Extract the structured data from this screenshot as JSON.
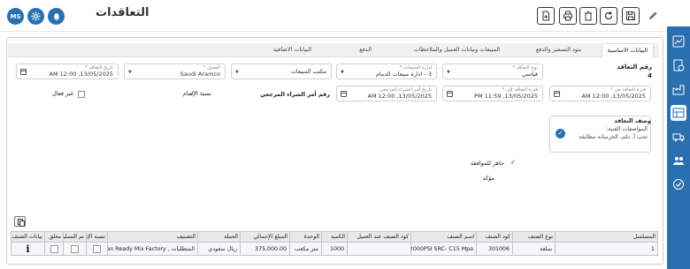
{
  "header": {
    "title": "التعاقدات",
    "user_initials": "MS"
  },
  "tabs": [
    {
      "label": "البيانات الاساسية"
    },
    {
      "label": "بنود التسعير والدفع"
    },
    {
      "label": "المبيعات وبيانات العميل والملاحظات"
    },
    {
      "label": "الدفع"
    },
    {
      "label": "البيانات الاضافية"
    }
  ],
  "form": {
    "contract_no": {
      "label": "رقم التعاقد",
      "value": "4"
    },
    "contract_type": {
      "label": "نوع التعاقد *",
      "value": "قياسي"
    },
    "sales_admin": {
      "label": "إدارة المبيعات *",
      "value": "3 - ادارة مبيعات الدمام"
    },
    "sales_office": {
      "label": "",
      "value": "مكتب المبيعات"
    },
    "customer": {
      "label": "العميل *",
      "value": "Saudi Aramco"
    },
    "contract_date": {
      "label": "تاريخ التعاقد *",
      "value": "13/05/2025, 12:00 AM"
    },
    "period_from": {
      "label": "فترة التعاقد من *",
      "value": "13/05/2025, 12:00 AM"
    },
    "period_to": {
      "label": "فترة التعاقد إلى *",
      "value": "13/05/2025, 11:59 PM"
    },
    "po_date": {
      "label": "تاريخ أمر الشراء المرجعي",
      "value": "13/05/2025, 12:00 AM"
    },
    "po_ref_label": "رقم أمر الشراء المرجعي",
    "completion_ratio": "نسبة الإتمام",
    "inactive": "غير فعال",
    "desc_label": "وصف التعاقد",
    "desc_line1": "المواصفات الفنية:",
    "desc_line2": "نحب أ. تكم، الخرسانة مطابقة",
    "ready_for_approval": "جاهز للموافقة",
    "confirmed": "مؤكد"
  },
  "table": {
    "columns": [
      "المسلسل",
      "نوع الصنف",
      "كود الصنف",
      "اسم الصنف",
      "كود الصنف عند العميل",
      "الكمية",
      "الوحدة",
      "المبلغ الإجمالي",
      "العملة",
      "التصنيف",
      "نسبة الإتمام",
      "تم التسليم",
      "معلق",
      "بيانات الصنف"
    ],
    "rows": [
      {
        "serial": "1",
        "item_type": "سلعة",
        "item_code": "301006",
        "item_name": "2000PSI SRC- C15 Mpa",
        "customer_code": "",
        "qty": "1000",
        "unit": "متر مكعب",
        "total": "375,000.00",
        "currency": "ريال سعودي",
        "classification": "المتطلبات , Najran Ready Mix Factory"
      }
    ]
  },
  "colors": {
    "primary": "#2a6fb0",
    "check_blue": "#2a6fb0"
  }
}
